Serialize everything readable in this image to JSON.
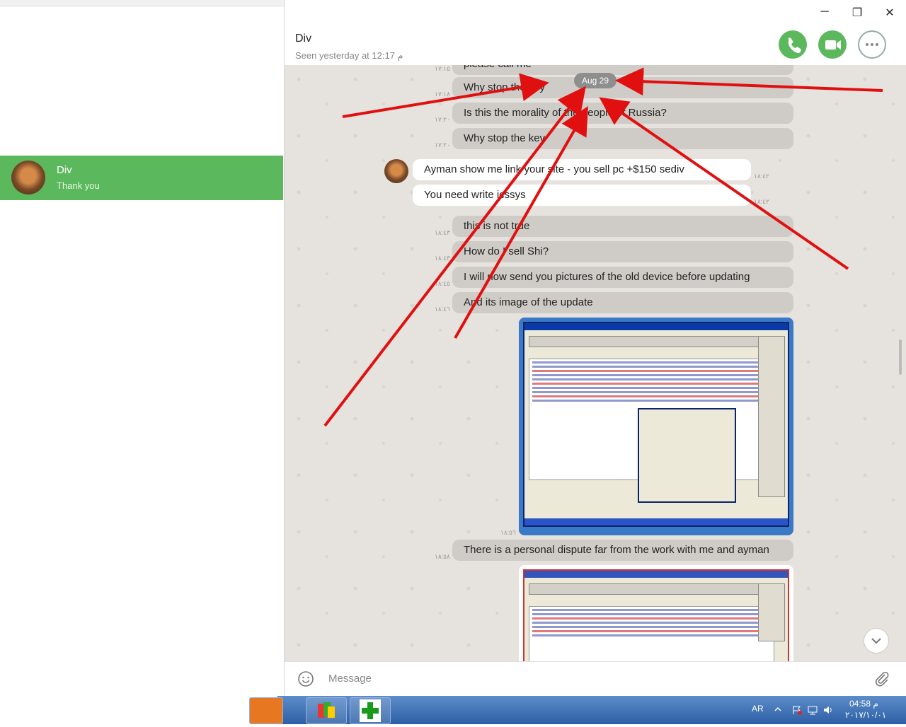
{
  "sidebar": {
    "chats": [
      {
        "name": "Div",
        "preview": "Thank you",
        "active": true
      }
    ]
  },
  "window": {
    "minimize": "─",
    "restore": "❐",
    "close": "✕"
  },
  "header": {
    "title": "Div",
    "status": "Seen yesterday at 12:17 م",
    "call_icon": "phone-icon",
    "video_icon": "video-icon",
    "more_icon": "more-icon"
  },
  "conversation": {
    "date_separator": "Aug 29",
    "messages": [
      {
        "text": "please call me",
        "direction": "out",
        "time": "١٧:١٥"
      },
      {
        "text": "Why stop the key",
        "direction": "out",
        "time": "١٧:١٨"
      },
      {
        "text": "Is this the morality of the people of Russia?",
        "direction": "out",
        "time": "١٧:٢٠"
      },
      {
        "text": "Why stop the key",
        "direction": "out",
        "time": "١٧:٢٠"
      },
      {
        "text": "Ayman show me link your site - you sell pc +$150 sediv",
        "direction": "in",
        "time": "١٨:٤٢"
      },
      {
        "text": "You need write icssys",
        "direction": "in",
        "time": "١٨:٤٢"
      },
      {
        "text": "this is not true",
        "direction": "out",
        "time": "١٨:٤٣"
      },
      {
        "text": "How do I sell Shi?",
        "direction": "out",
        "time": "١٨:٤٣"
      },
      {
        "text": "I will now send you pictures of the old device before updating",
        "direction": "out",
        "time": "١٨:٤٥"
      },
      {
        "text": "And its image of the update",
        "direction": "out",
        "time": "١٨:٤٦"
      },
      {
        "text": "There is a personal dispute far from the work with me and ayman",
        "direction": "out",
        "time": "١٨:٥٨"
      }
    ],
    "image_times": [
      "١٨:٥٦"
    ]
  },
  "composer": {
    "placeholder": "Message",
    "emoji_icon": "emoji-icon",
    "attach_icon": "paperclip-icon"
  },
  "taskbar": {
    "language": "AR",
    "time": "04:58 م",
    "date": "٢٠١٧/١٠/٠١"
  },
  "colors": {
    "accent_green": "#5cb85c",
    "outgoing_bubble": "#cfccc7",
    "incoming_bubble": "#ffffff",
    "annotation_arrows": "#e01010"
  }
}
